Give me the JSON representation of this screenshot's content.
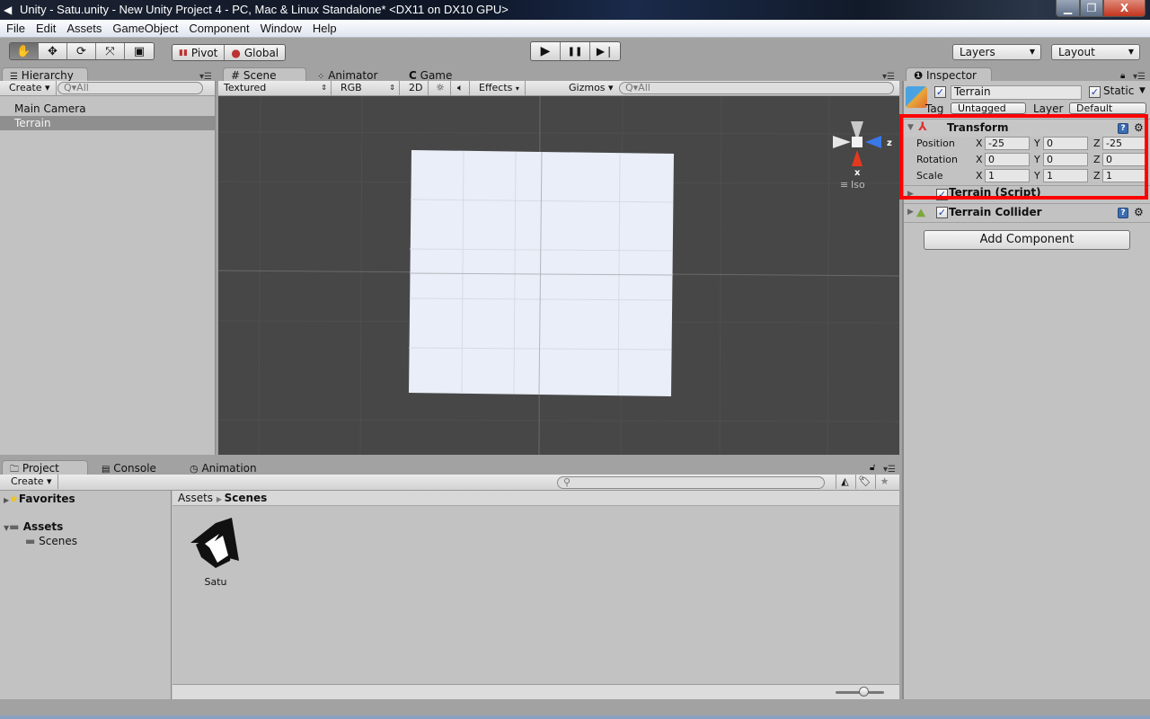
{
  "window": {
    "title": "Unity - Satu.unity - New Unity Project 4 - PC, Mac & Linux Standalone* <DX11 on DX10 GPU>",
    "controls": {
      "minimize": "▁",
      "maximize": "❐",
      "close": "X"
    }
  },
  "menubar": [
    "File",
    "Edit",
    "Assets",
    "GameObject",
    "Component",
    "Window",
    "Help"
  ],
  "toolbar": {
    "tools": [
      {
        "name": "hand-tool",
        "icon": "✋",
        "active": true
      },
      {
        "name": "move-tool",
        "icon": "✥",
        "active": false
      },
      {
        "name": "rotate-tool",
        "icon": "⟳",
        "active": false
      },
      {
        "name": "scale-tool",
        "icon": "⤧",
        "active": false
      },
      {
        "name": "rect-tool",
        "icon": "▣",
        "active": false
      }
    ],
    "pivot_label": "Pivot",
    "global_label": "Global",
    "play_icon": "▶",
    "pause_icon": "❚❚",
    "step_icon": "▶❘",
    "layers_label": "Layers",
    "layout_label": "Layout"
  },
  "hierarchy": {
    "tab_label": "Hierarchy",
    "create_label": "Create ▾",
    "search_placeholder": "Q▾All",
    "items": [
      {
        "label": "Main Camera",
        "selected": false
      },
      {
        "label": "Terrain",
        "selected": true
      }
    ]
  },
  "scene": {
    "tabs": [
      "Scene",
      "Animator",
      "Game"
    ],
    "active_tab": "Scene",
    "shading_mode": "Textured",
    "render_mode": "RGB",
    "toggle_2d": "2D",
    "effects_label": "Effects",
    "gizmos_label": "Gizmos ▾",
    "search_placeholder": "Q▾All",
    "gizmo": {
      "x_label": "x",
      "z_label": "z",
      "projection": "Iso"
    }
  },
  "inspector": {
    "tab_label": "Inspector",
    "object_name": "Terrain",
    "active": true,
    "static_label": "Static",
    "static_checked": true,
    "tag_label": "Tag",
    "tag_value": "Untagged",
    "layer_label": "Layer",
    "layer_value": "Default",
    "transform": {
      "title": "Transform",
      "rows": [
        {
          "label": "Position",
          "x": "-25",
          "y": "0",
          "z": "-25"
        },
        {
          "label": "Rotation",
          "x": "0",
          "y": "0",
          "z": "0"
        },
        {
          "label": "Scale",
          "x": "1",
          "y": "1",
          "z": "1"
        }
      ],
      "axis_labels": [
        "X",
        "Y",
        "Z"
      ]
    },
    "components": [
      {
        "title": "Terrain (Script)",
        "enabled": true
      },
      {
        "title": "Terrain Collider",
        "enabled": true
      }
    ],
    "add_component_label": "Add Component",
    "highlight_color": "#ff0000"
  },
  "project": {
    "tabs": [
      "Project",
      "Console",
      "Animation"
    ],
    "active_tab": "Project",
    "create_label": "Create ▾",
    "tree": {
      "favorites_label": "Favorites",
      "assets_label": "Assets",
      "scenes_label": "Scenes"
    },
    "breadcrumb": [
      "Assets",
      "Scenes"
    ],
    "assets": [
      {
        "name": "Satu",
        "type": "unity-scene"
      }
    ],
    "thumbnail_size": 0.55
  }
}
